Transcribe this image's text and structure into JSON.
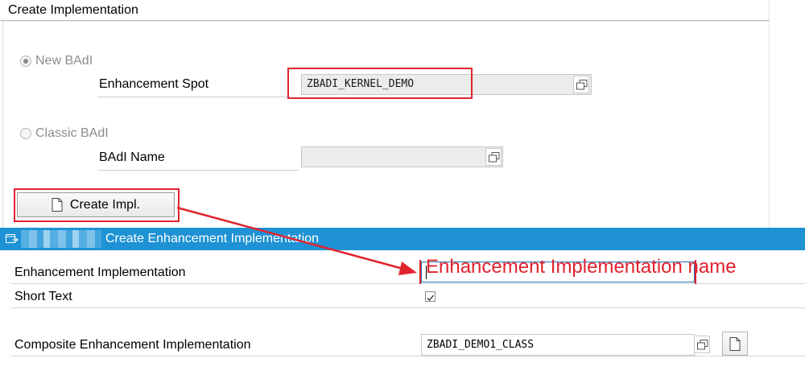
{
  "panel": {
    "title": "Create Implementation",
    "new_badi_label": "New BAdI",
    "enhancement_spot_label": "Enhancement Spot",
    "enhancement_spot_value": "ZBADI_KERNEL_DEMO",
    "classic_badi_label": "Classic BAdI",
    "badi_name_label": "BAdI Name",
    "badi_name_value": "",
    "create_impl_button": "Create Impl."
  },
  "dialog": {
    "title": "Create Enhancement Implementation",
    "enhancement_implementation_label": "Enhancement Implementation",
    "enhancement_implementation_value": "",
    "annotation_text": "Enhancement Implementation name",
    "short_text_label": "Short Text",
    "short_text_checked": true,
    "composite_label": "Composite Enhancement Implementation",
    "composite_value": "ZBADI_DEMO1_CLASS"
  },
  "colors": {
    "dialog_titlebar": "#1e92d4",
    "annotation_red": "#e0232e"
  },
  "icons": {
    "search_help": "value-help-icon",
    "new_document": "new-document-icon",
    "dialog": "dialog-icon"
  }
}
